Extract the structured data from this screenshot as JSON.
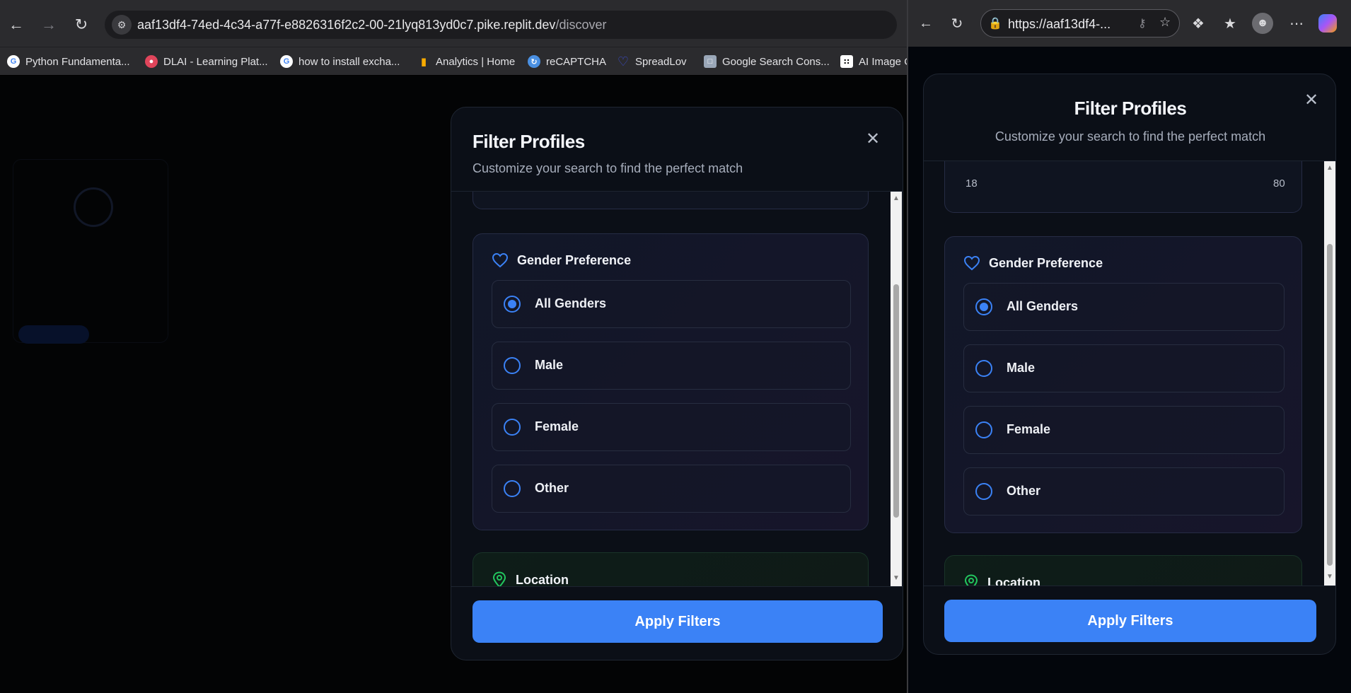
{
  "left_browser": {
    "url_host": "aaf13df4-74ed-4c34-a77f-e8826316f2c2-00-21lyq813yd0c7.pike.replit.dev",
    "url_path": "/discover",
    "bookmarks": [
      {
        "label": "Python Fundamenta...",
        "icon": "google-icon",
        "color": "#4285f4"
      },
      {
        "label": "DLAI - Learning Plat...",
        "icon": "dlai-icon",
        "color": "#e0455b"
      },
      {
        "label": "how to install excha...",
        "icon": "google-icon",
        "color": "#4285f4"
      },
      {
        "label": "Analytics | Home",
        "icon": "analytics-icon",
        "color": "#f9ab00"
      },
      {
        "label": "reCAPTCHA",
        "icon": "recaptcha-icon",
        "color": "#4a90e2"
      },
      {
        "label": "SpreadLov",
        "icon": "heart-icon",
        "color": "#3d4fd6"
      },
      {
        "label": "Google Search Cons...",
        "icon": "search-console-icon",
        "color": "#9aa7b8"
      },
      {
        "label": "AI Image C",
        "icon": "dice-icon",
        "color": "#ffffff"
      }
    ]
  },
  "right_browser": {
    "url": "https://aaf13df4-..."
  },
  "modal": {
    "title": "Filter Profiles",
    "subtitle": "Customize your search to find the perfect match",
    "gender_section_title": "Gender Preference",
    "gender_options": [
      {
        "label": "All Genders",
        "selected": true
      },
      {
        "label": "Male",
        "selected": false
      },
      {
        "label": "Female",
        "selected": false
      },
      {
        "label": "Other",
        "selected": false
      }
    ],
    "location_section_title": "Location",
    "apply_label": "Apply Filters"
  },
  "age_range": {
    "min_label": "18",
    "max_label": "80"
  },
  "colors": {
    "accent": "#3b82f6",
    "location_accent": "#22c55e"
  }
}
